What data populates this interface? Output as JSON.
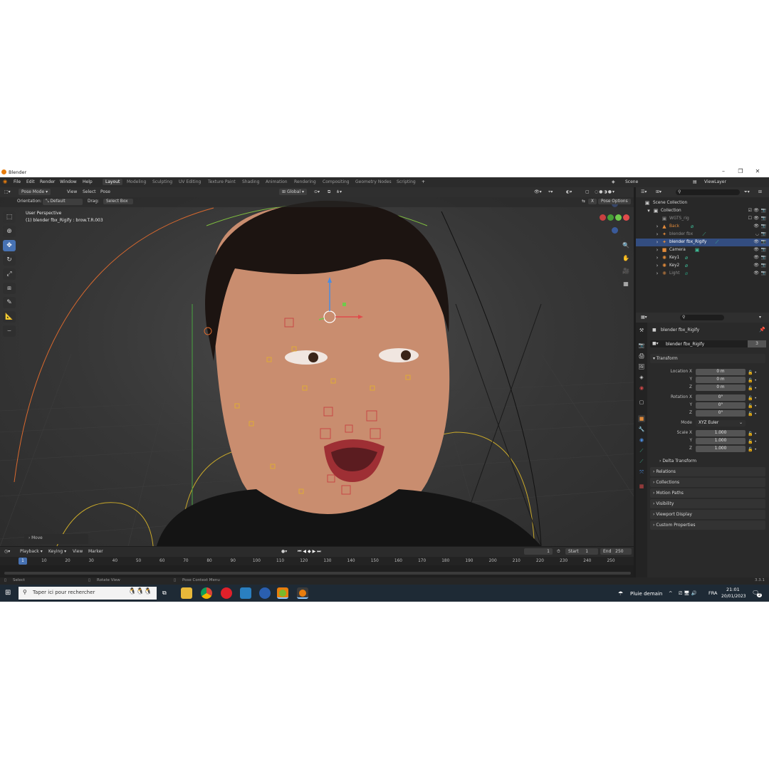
{
  "window": {
    "title": "Blender"
  },
  "menu": [
    "File",
    "Edit",
    "Render",
    "Window",
    "Help"
  ],
  "workspaces": [
    "Layout",
    "Modeling",
    "Sculpting",
    "UV Editing",
    "Texture Paint",
    "Shading",
    "Animation",
    "Rendering",
    "Compositing",
    "Geometry Nodes",
    "Scripting"
  ],
  "active_workspace": "Layout",
  "scene": {
    "name": "Scene",
    "view_layer": "ViewLayer"
  },
  "viewport_header": {
    "mode": "Pose Mode",
    "menus": [
      "View",
      "Select",
      "Pose"
    ],
    "transform_orientation": "Global",
    "orientation_label": "Orientation:",
    "orientation_value": "Default",
    "drag_label": "Drag:",
    "drag_value": "Select Box",
    "pose_options": "Pose Options",
    "x_label": "X"
  },
  "viewport_info": {
    "line1": "User Perspective",
    "line2": "(1) blender fbx_Rigify : brow.T.R.003"
  },
  "last_operator": "Move",
  "timeline": {
    "menus": [
      "Playback",
      "Keying",
      "View",
      "Marker"
    ],
    "current_frame": "1",
    "start_label": "Start",
    "start": "1",
    "end_label": "End",
    "end": "250",
    "ruler": [
      "1",
      "10",
      "20",
      "30",
      "40",
      "50",
      "60",
      "70",
      "80",
      "90",
      "100",
      "110",
      "120",
      "130",
      "140",
      "150",
      "160",
      "170",
      "180",
      "190",
      "200",
      "210",
      "220",
      "230",
      "240",
      "250"
    ]
  },
  "statusbar": {
    "select": "Select",
    "rotate": "Rotate View",
    "context": "Pose Context Menu",
    "version": "3.3.1"
  },
  "outliner": {
    "root": "Scene Collection",
    "items": [
      {
        "name": "Collection",
        "dim": false
      },
      {
        "name": "WGTS_rig",
        "dim": true
      },
      {
        "name": "Back",
        "dim": true
      },
      {
        "name": "blender fbx",
        "dim": true
      },
      {
        "name": "blender fbx_Rigify",
        "dim": false,
        "selected": true
      },
      {
        "name": "Camera",
        "dim": false
      },
      {
        "name": "Key1",
        "dim": false
      },
      {
        "name": "Key2",
        "dim": false
      },
      {
        "name": "Light",
        "dim": true
      }
    ]
  },
  "properties": {
    "object_name": "blender fbx_Rigify",
    "data_name": "blender fbx_Rigify",
    "users": "3",
    "transform_title": "Transform",
    "location": {
      "label": "Location X",
      "x": "0 m",
      "y": "0 m",
      "z": "0 m"
    },
    "rotation": {
      "label": "Rotation X",
      "x": "0°",
      "y": "0°",
      "z": "0°"
    },
    "mode_label": "Mode",
    "mode_value": "XYZ Euler",
    "scale": {
      "label": "Scale X",
      "x": "1.000",
      "y": "1.000",
      "z": "1.000"
    },
    "axis_y": "Y",
    "axis_z": "Z",
    "delta": "Delta Transform",
    "sections": [
      "Relations",
      "Collections",
      "Motion Paths",
      "Visibility",
      "Viewport Display",
      "Custom Properties"
    ]
  },
  "taskbar": {
    "search_placeholder": "Taper ici pour rechercher",
    "weather": "Pluie demain",
    "lang": "FRA",
    "time": "21:01",
    "date": "20/01/2023",
    "notif": "2"
  }
}
